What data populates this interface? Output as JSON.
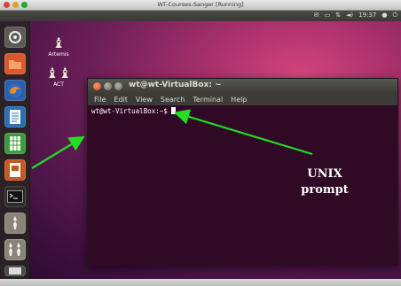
{
  "host_window": {
    "title": "WT-Courses-Sanger [Running]"
  },
  "guest_panel": {
    "clock": "19:37"
  },
  "desktop_icons": [
    {
      "label": "Artemis",
      "icon": "chess-piece-icon"
    },
    {
      "label": "ACT",
      "icon": "chess-pair-icon"
    }
  ],
  "launcher": {
    "items": [
      {
        "icon": "ubuntu-dash-icon"
      },
      {
        "icon": "home-folder-icon"
      },
      {
        "icon": "firefox-icon"
      },
      {
        "icon": "writer-icon"
      },
      {
        "icon": "calc-icon"
      },
      {
        "icon": "impress-icon"
      },
      {
        "icon": "terminal-icon"
      },
      {
        "icon": "artemis-icon"
      },
      {
        "icon": "act-icon"
      },
      {
        "icon": "workspace-icon"
      },
      {
        "icon": "trash-icon"
      }
    ]
  },
  "terminal": {
    "title": "wt@wt-VirtualBox: ~",
    "menu": [
      "File",
      "Edit",
      "View",
      "Search",
      "Terminal",
      "Help"
    ],
    "prompt": "wt@wt-VirtualBox:~$ "
  },
  "annotation": {
    "line1": "UNIX",
    "line2": "prompt"
  },
  "colors": {
    "terminal_bg": "#300a24",
    "arrow": "#22dd22",
    "accent": "#dd4814"
  }
}
